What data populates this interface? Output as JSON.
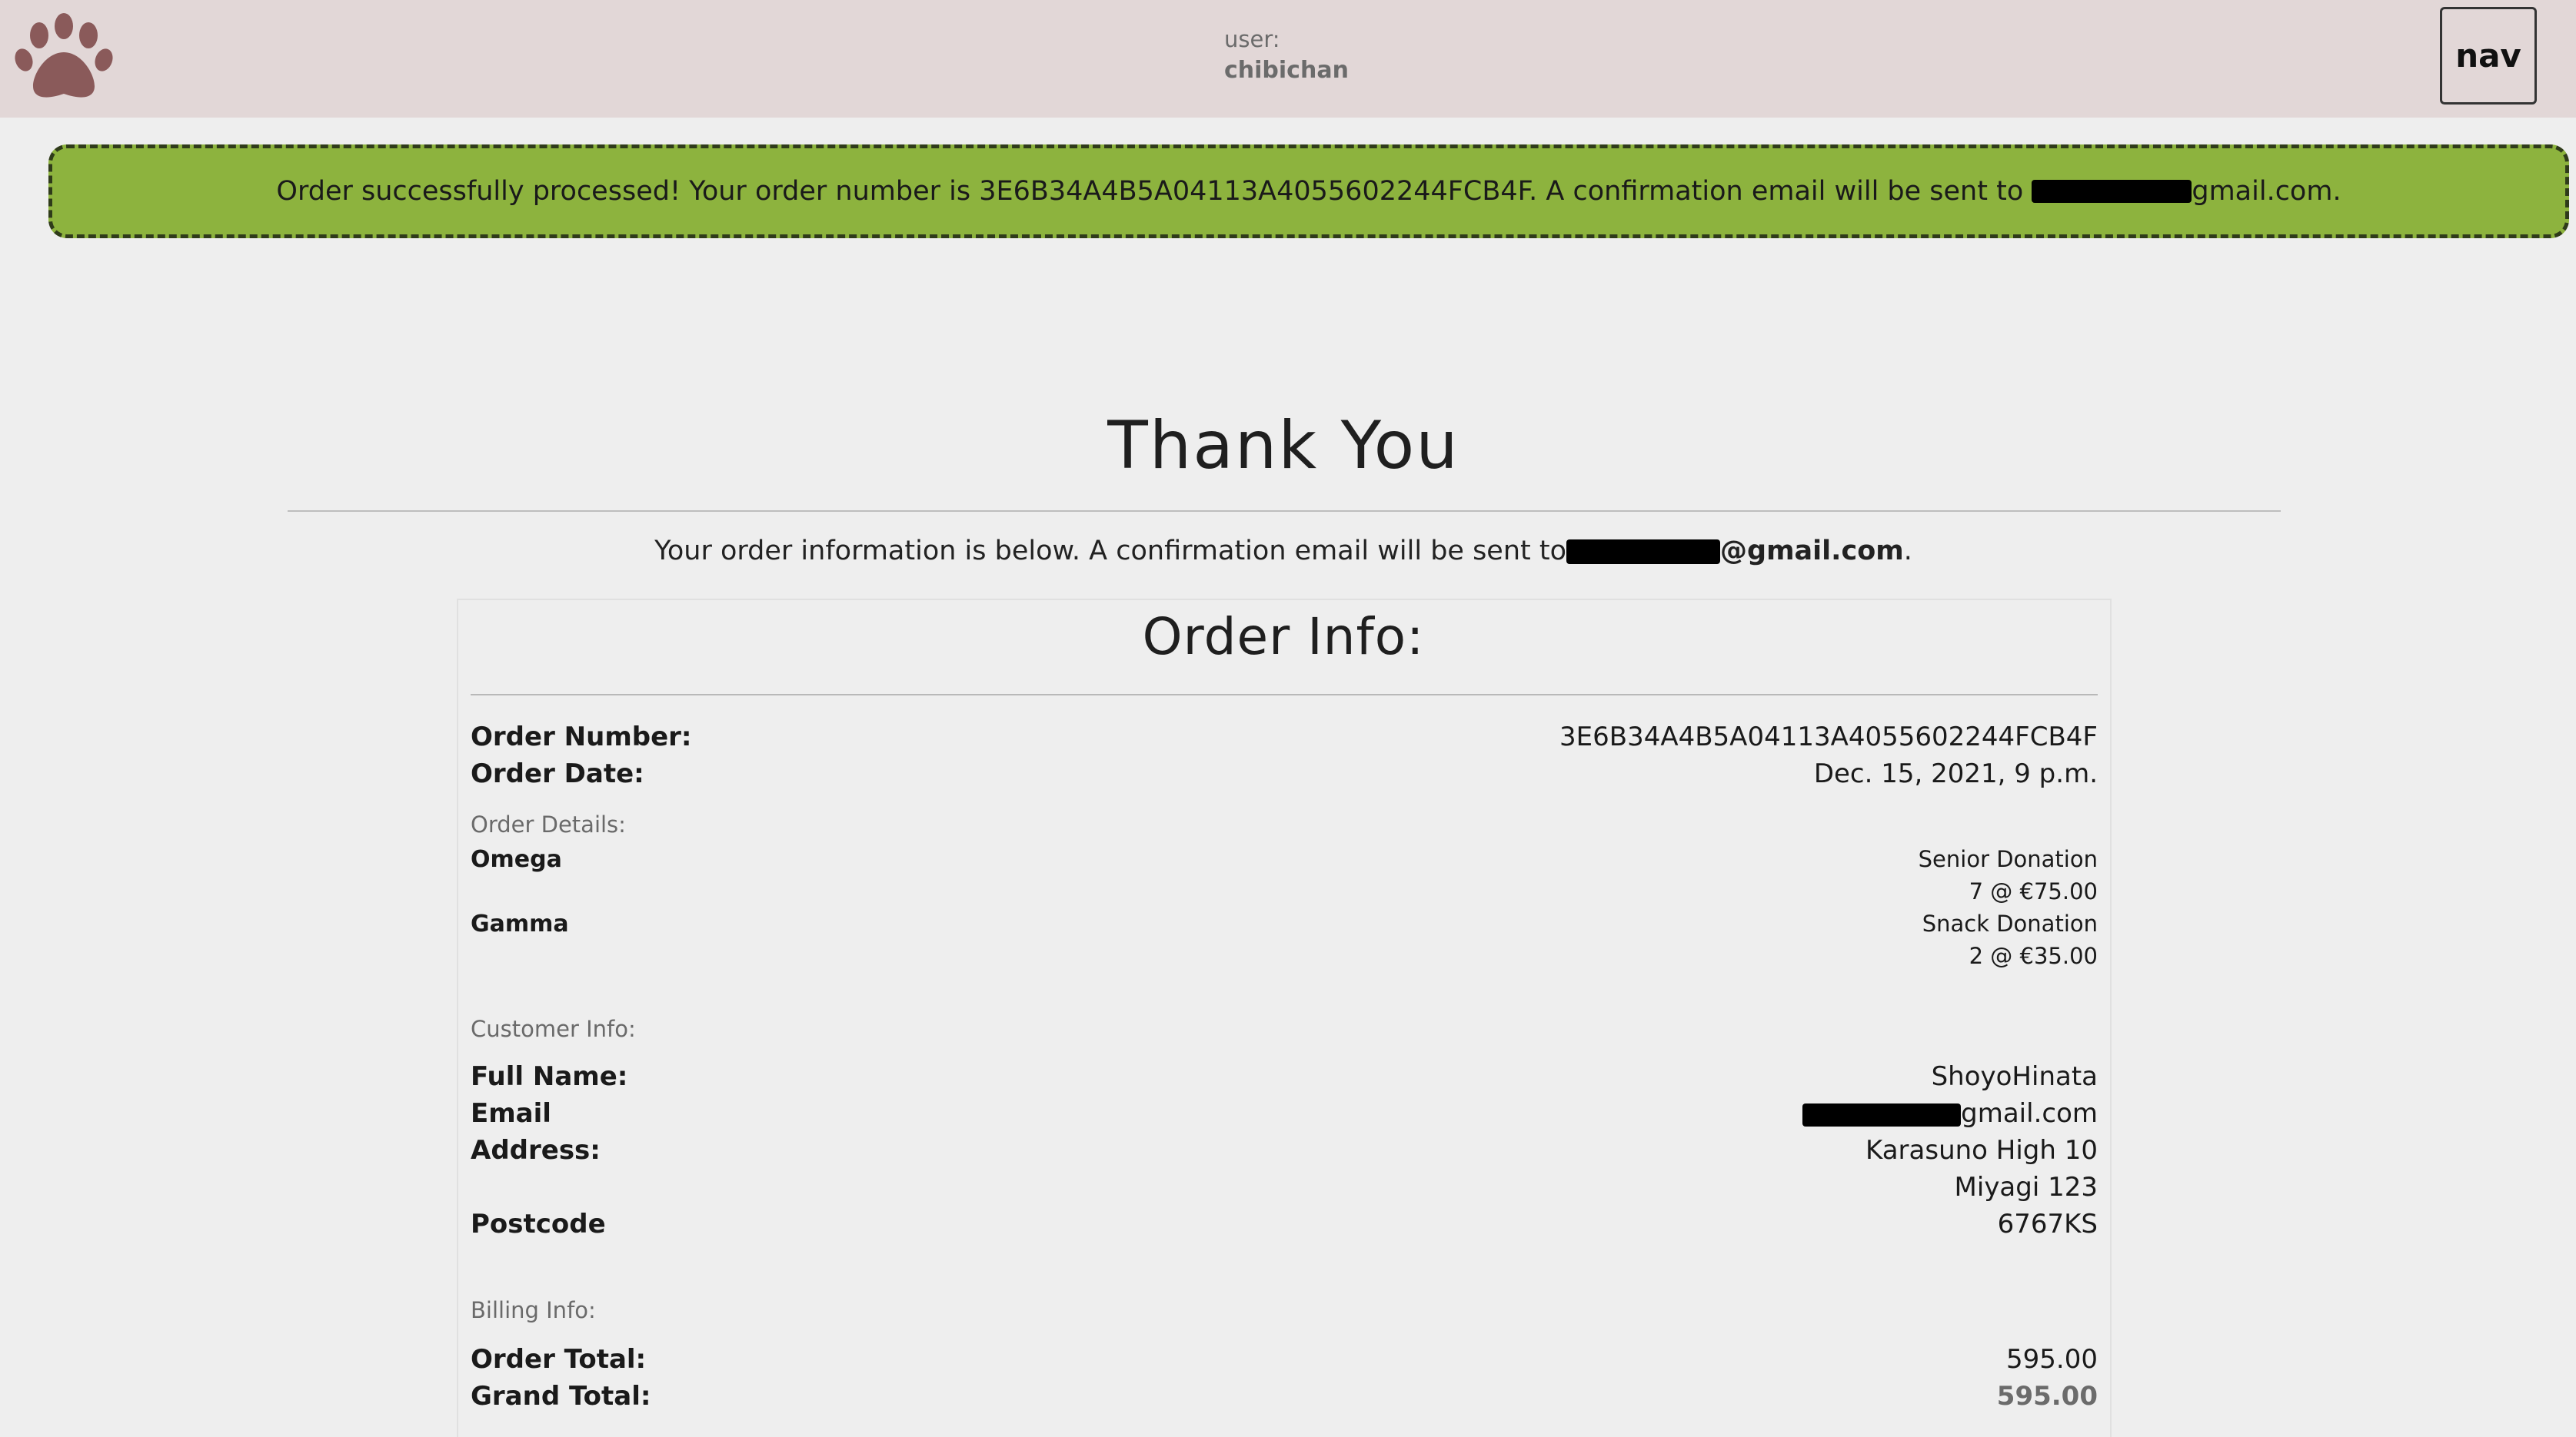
{
  "header": {
    "logo_icon": "paw-icon",
    "user_label": "user:",
    "username": "chibichan",
    "nav_label": "nav"
  },
  "alert": {
    "text_before": "Order successfully processed! Your order number is 3E6B34A4B5A04113A4055602244FCB4F. A confirmation email will be sent to ",
    "text_after": "gmail.com."
  },
  "main": {
    "title": "Thank You",
    "intro_before": "Your order information is below. A confirmation email will be sent to",
    "intro_email_tail": "@gmail.com",
    "intro_end": "."
  },
  "order_info": {
    "title": "Order Info:",
    "order_number_label": "Order Number:",
    "order_number": "3E6B34A4B5A04113A4055602244FCB4F",
    "order_date_label": "Order Date:",
    "order_date": "Dec. 15, 2021, 9 p.m.",
    "details_heading": "Order Details:",
    "items": [
      {
        "name": "Omega",
        "product": "Senior Donation",
        "qty_price": "7 @ €75.00"
      },
      {
        "name": "Gamma",
        "product": "Snack Donation",
        "qty_price": "2 @ €35.00"
      }
    ],
    "customer_heading": "Customer Info:",
    "full_name_label": "Full Name:",
    "full_name": "ShoyoHinata",
    "email_label": "Email",
    "email_tail": "gmail.com",
    "address_label": "Address:",
    "address_line1": "Karasuno High 10",
    "address_line2": "Miyagi 123",
    "postcode_label": "Postcode",
    "postcode": "6767KS",
    "billing_heading": "Billing Info:",
    "order_total_label": "Order Total:",
    "order_total": "595.00",
    "grand_total_label": "Grand Total:",
    "grand_total": "595.00"
  },
  "colors": {
    "header_bg": "#e2d7d7",
    "alert_bg": "#8db33e",
    "page_bg": "#eeeeee",
    "paw": "#8a5a5a"
  }
}
